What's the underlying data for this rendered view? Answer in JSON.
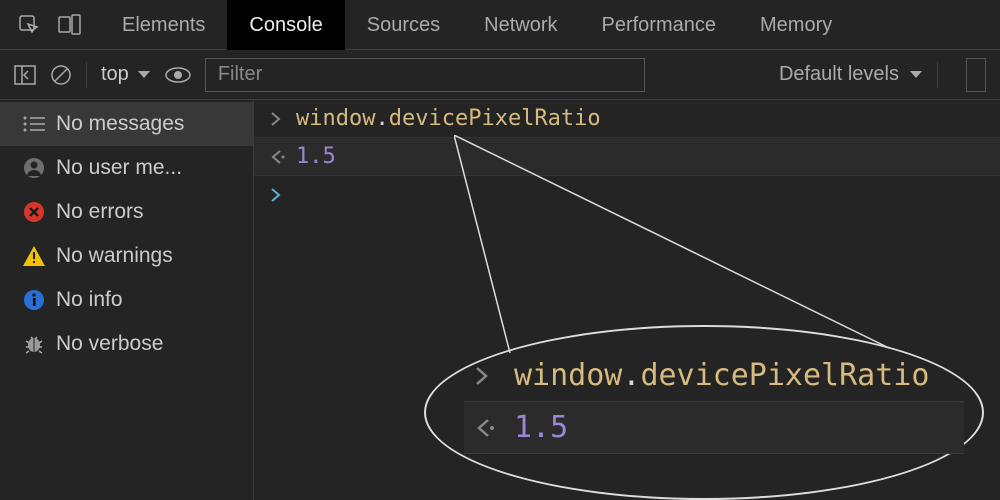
{
  "tabs": {
    "elements": "Elements",
    "console": "Console",
    "sources": "Sources",
    "network": "Network",
    "performance": "Performance",
    "memory": "Memory"
  },
  "toolbar": {
    "context": "top",
    "filter_placeholder": "Filter",
    "levels": "Default levels"
  },
  "sidebar": {
    "no_messages": "No messages",
    "no_user": "No user me...",
    "no_errors": "No errors",
    "no_warnings": "No warnings",
    "no_info": "No info",
    "no_verbose": "No verbose"
  },
  "console": {
    "input_obj": "window",
    "input_dot": ".",
    "input_prop": "devicePixelRatio",
    "result": "1.5"
  },
  "zoom": {
    "input_obj": "window",
    "input_dot": ".",
    "input_prop": "devicePixelRatio",
    "result": "1.5"
  }
}
